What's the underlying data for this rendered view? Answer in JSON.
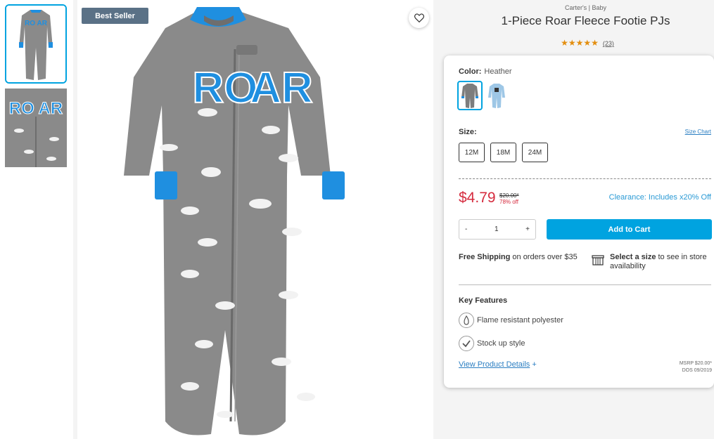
{
  "product": {
    "brand": "Carter's | Baby",
    "title": "1-Piece Roar Fleece Footie PJs",
    "stars": "★★★★★",
    "review_count": "(23)",
    "badge": "Best Seller"
  },
  "color": {
    "label": "Color:",
    "value": "Heather"
  },
  "size": {
    "label": "Size:",
    "chart_link": "Size Chart",
    "options": [
      "12M",
      "18M",
      "24M"
    ]
  },
  "price": {
    "current": "$4.79",
    "was": "$20.00*",
    "percent_off": "78% off",
    "clearance": "Clearance: Includes x20% Off"
  },
  "cart": {
    "minus": "-",
    "quantity": "1",
    "plus": "+",
    "add_label": "Add to Cart"
  },
  "shipping": {
    "bold": "Free Shipping",
    "text": " on orders over $35"
  },
  "store": {
    "bold": "Select a size",
    "text": " to see in store availability"
  },
  "key_features": {
    "title": "Key Features",
    "items": [
      "Flame resistant polyester",
      "Stock up style"
    ]
  },
  "details": {
    "link": "View Product Details",
    "plus": "+",
    "msrp": "MSRP $20.00*",
    "dos": "DOS 09/2019"
  },
  "colors": {
    "accent": "#00a3e0",
    "price_red": "#d52b3e",
    "pajama_gray": "#8a8a8a",
    "cuff_blue": "#1f8fe0"
  }
}
